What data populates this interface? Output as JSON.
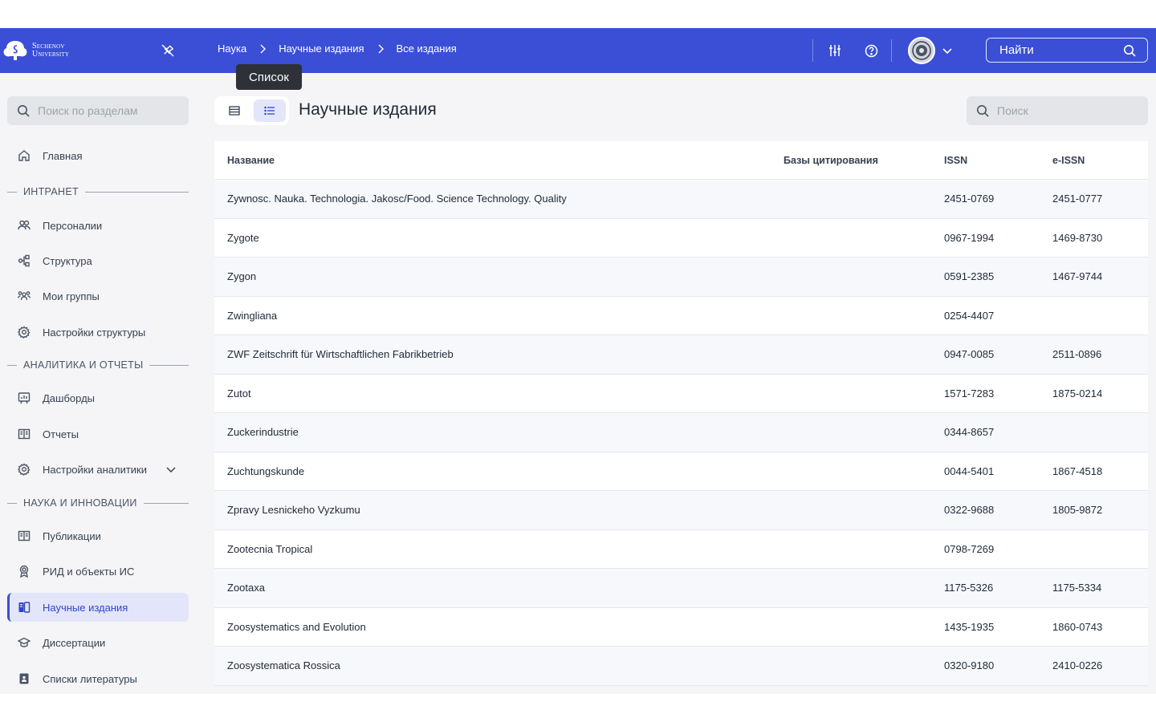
{
  "header": {
    "logo_line1": "Sechenov",
    "logo_line2": "University",
    "breadcrumbs": [
      "Наука",
      "Научные издания",
      "Все издания"
    ],
    "find_label": "Найти",
    "accent": "#3a4fd6"
  },
  "tooltip": "Список",
  "sidebar": {
    "search_placeholder": "Поиск по разделам",
    "home": "Главная",
    "sections": [
      {
        "title": "ИНТРАНЕТ",
        "items": [
          "Персоналии",
          "Структура",
          "Мои группы",
          "Настройки структуры"
        ]
      },
      {
        "title": "АНАЛИТИКА И ОТЧЕТЫ",
        "items": [
          "Дашборды",
          "Отчеты",
          "Настройки аналитики"
        ]
      },
      {
        "title": "НАУКА И ИННОВАЦИИ",
        "items": [
          "Публикации",
          "РИД и объекты ИС",
          "Научные издания",
          "Диссертации",
          "Списки литературы"
        ]
      }
    ],
    "active_item": "Научные издания"
  },
  "main": {
    "title": "Научные издания",
    "search_placeholder": "Поиск",
    "columns": [
      "Название",
      "Базы цитирования",
      "ISSN",
      "e-ISSN"
    ],
    "rows": [
      [
        "Zywnosc. Nauka. Technologia. Jakosc/Food. Science Technology. Quality",
        "",
        "2451-0769",
        "2451-0777"
      ],
      [
        "Zygote",
        "",
        "0967-1994",
        "1469-8730"
      ],
      [
        "Zygon",
        "",
        "0591-2385",
        "1467-9744"
      ],
      [
        "Zwingliana",
        "",
        "0254-4407",
        ""
      ],
      [
        "ZWF Zeitschrift für Wirtschaftlichen Fabrikbetrieb",
        "",
        "0947-0085",
        "2511-0896"
      ],
      [
        "Zutot",
        "",
        "1571-7283",
        "1875-0214"
      ],
      [
        "Zuckerindustrie",
        "",
        "0344-8657",
        ""
      ],
      [
        "Zuchtungskunde",
        "",
        "0044-5401",
        "1867-4518"
      ],
      [
        "Zpravy Lesnickeho Vyzkumu",
        "",
        "0322-9688",
        "1805-9872"
      ],
      [
        "Zootecnia Tropical",
        "",
        "0798-7269",
        ""
      ],
      [
        "Zootaxa",
        "",
        "1175-5326",
        "1175-5334"
      ],
      [
        "Zoosystematics and Evolution",
        "",
        "1435-1935",
        "1860-0743"
      ],
      [
        "Zoosystematica Rossica",
        "",
        "0320-9180",
        "2410-0226"
      ]
    ]
  }
}
